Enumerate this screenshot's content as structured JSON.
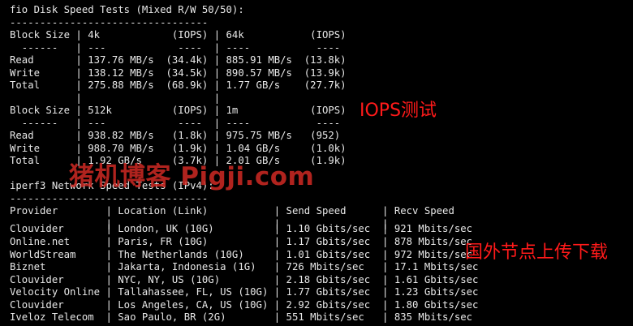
{
  "terminal": {
    "lines": [
      "fio Disk Speed Tests (Mixed R/W 50/50):",
      "---------------------------------",
      "Block Size | 4k            (IOPS) | 64k           (IOPS)",
      "  ------   | ---            ----  | ----           ----",
      "Read       | 137.76 MB/s  (34.4k) | 885.91 MB/s  (13.8k)",
      "Write      | 138.12 MB/s  (34.5k) | 890.57 MB/s  (13.9k)",
      "Total      | 275.88 MB/s  (68.9k) | 1.77 GB/s    (27.7k)",
      "           |                      |",
      "Block Size | 512k          (IOPS) | 1m            (IOPS)",
      "  ------   | ---            ----  | ----           ----",
      "Read       | 938.82 MB/s   (1.8k) | 975.75 MB/s   (952)",
      "Write      | 988.70 MB/s   (1.9k) | 1.04 GB/s     (1.0k)",
      "Total      | 1.92 GB/s     (3.7k) | 2.01 GB/s     (1.9k)",
      "",
      "iperf3 Network Speed Tests (IPv4):",
      "---------------------------------",
      "Provider        | Location (Link)           | Send Speed      | Recv Speed",
      "                |                           |                 |",
      "Clouvider       | London, UK (10G)          | 1.10 Gbits/sec  | 921 Mbits/sec",
      "Online.net      | Paris, FR (10G)           | 1.17 Gbits/sec  | 878 Mbits/sec",
      "WorldStream     | The Netherlands (10G)     | 1.01 Gbits/sec  | 972 Mbits/sec",
      "Biznet          | Jakarta, Indonesia (1G)   | 726 Mbits/sec   | 17.1 Mbits/sec",
      "Clouvider       | NYC, NY, US (10G)         | 2.18 Gbits/sec  | 1.61 Gbits/sec",
      "Velocity Online | Tallahassee, FL, US (10G) | 1.77 Gbits/sec  | 1.23 Gbits/sec",
      "Clouvider       | Los Angeles, CA, US (10G) | 2.92 Gbits/sec  | 1.80 Gbits/sec",
      "Iveloz Telecom  | Sao Paulo, BR (2G)        | 551 Mbits/sec   | 835 Mbits/sec"
    ]
  },
  "annotations": {
    "iops_test": "IOPS测试",
    "intl_nodes": "国外节点上传下载",
    "watermark": "猪机博客 Pigji.com"
  },
  "colors": {
    "background": "#000000",
    "terminal_text": "#e8e8e8",
    "annotation": "#ff1a1a",
    "watermark": "#cf2a24"
  }
}
